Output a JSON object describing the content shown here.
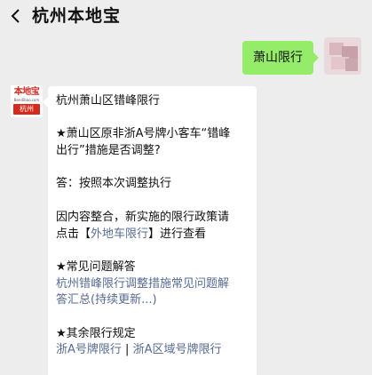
{
  "header": {
    "title": "杭州本地宝"
  },
  "sent_message": {
    "text": "萧山限行"
  },
  "bot_avatar": {
    "logo_text": "本地宝",
    "logo_sub": "Bendibao.com",
    "city": "杭州"
  },
  "reply": {
    "line1": "杭州萧山区错峰限行",
    "q_line1": "★萧山区原非浙A号牌小客车“错峰",
    "q_line2": "出行”措施是否调整?",
    "answer": "答：按照本次调整执行",
    "notice_line1": "因内容整合，新实施的限行政策请",
    "notice_pre": "点击【",
    "notice_link": "外地车限行",
    "notice_post": "】进行查看",
    "faq_title": "★常见问题解答",
    "faq_link_line1": "杭州错峰限行调整措施常见问题解",
    "faq_link_line2": "答汇总(持续更新...)",
    "other_title": "★其余限行规定",
    "other_link1": "浙A号牌限行",
    "separator": "|",
    "other_link2": "浙A区域号牌限行"
  },
  "colors": {
    "background": "#ededed",
    "sent_bubble": "#95ec69",
    "link": "#576b95",
    "logo_red": "#d62a1e"
  }
}
